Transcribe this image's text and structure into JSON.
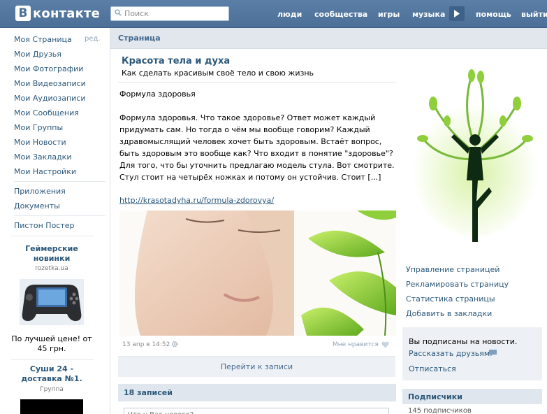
{
  "header": {
    "logo_letter": "В",
    "logo_text": "контакте",
    "search_placeholder": "Поиск",
    "nav": [
      "люди",
      "сообщества",
      "игры",
      "музыка",
      "помощь",
      "выйти"
    ],
    "colors": {
      "bar": "#4b6f97",
      "link": "#2b587a"
    }
  },
  "sidebar": {
    "edit_label": "ред.",
    "menu": [
      "Моя Страница",
      "Мои Друзья",
      "Мои Фотографии",
      "Мои Видеозаписи",
      "Мои Аудиозаписи",
      "Мои Сообщения",
      "Мои Группы",
      "Мои Новости",
      "Мои Закладки",
      "Мои Настройки"
    ],
    "extra": [
      "Приложения",
      "Документы"
    ],
    "poster": "Пистон Постер",
    "ad1": {
      "title": "Геймерские новинки",
      "source": "rozetka.ua",
      "text": "По лучшей цене! от 45 грн."
    },
    "ad2": {
      "title": "Суши 24 - доставка №1.",
      "source": "Группа"
    }
  },
  "main": {
    "breadcrumb": "Страница",
    "title": "Красота тела и духа",
    "description": "Как сделать красивым своё тело и свою жизнь",
    "post_heading": "Формула здоровья",
    "post_body": "Формула здоровья. Что такое здоровье? Ответ может каждый придумать сам. Но тогда о чём мы вообще говорим? Каждый здравомыслящий человек хочет быть здоровым. Встаёт вопрос, быть здоровым это вообще как? Что входит в понятие \"здоровье\"? Для того, что бы уточнить предлагаю модель стула. Вот смотрите. Стул стоит на четырёх ножках и потому он устойчив.  Стоит [...]",
    "post_link": "http://krasotadyha.ru/formula-zdorovya/",
    "post_date": "13 апр в 14:52",
    "like_label": "Мне нравится",
    "goto_label": "Перейти к записи",
    "posts_count_label": "18 записей",
    "input_placeholder": "Что у Вас нового?"
  },
  "right": {
    "actions": [
      "Управление страницей",
      "Рекламировать страницу",
      "Статистика страницы",
      "Добавить в закладки"
    ],
    "subscribed_text": "Вы подписаны на новости.",
    "tell_friends": "Рассказать друзьям",
    "unsubscribe": "Отписаться",
    "subscribers_title": "Подписчики",
    "subscribers_count": "145 подписчиков"
  }
}
